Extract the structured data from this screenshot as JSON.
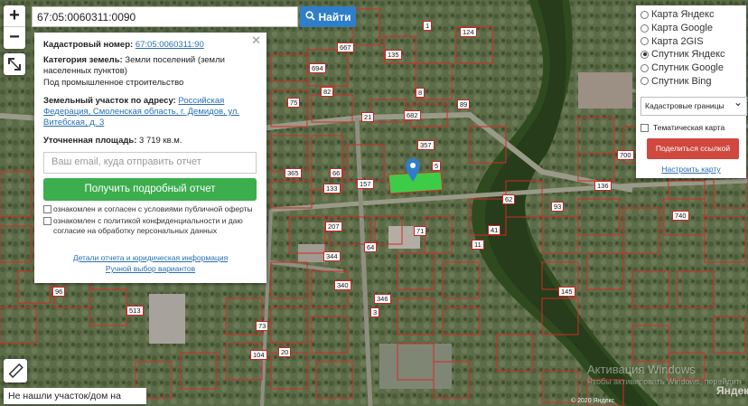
{
  "search": {
    "value": "67:05:0060311:0090",
    "button_label": "Найти"
  },
  "zoom": {
    "in": "+",
    "out": "−"
  },
  "info_panel": {
    "cadastral_label": "Кадастровый номер:",
    "cadastral_value": "67:05:0060311:90",
    "category_label": "Категория земель:",
    "category_value": "Земли поселений (земли населенных пунктов)",
    "usage_value": "Под промышленное строительство",
    "address_label": "Земельный участок по адресу:",
    "address_value": "Российская Федерация, Смоленская область, г. Демидов, ул. Витебская, д. 3",
    "area_label": "Уточненная площадь:",
    "area_value": "3 719 кв.м.",
    "email_placeholder": "Ваш email, куда отправить отчет",
    "report_button": "Получить подробный отчет",
    "consent_offer": "ознакомлен и согласен с условиями публичной оферты",
    "consent_privacy": "ознакомлен с политикой конфиденциальности и даю согласие на обработку персональных данных",
    "link_details": "Детали отчета и юридическая информация",
    "link_manual": "Ручной выбор вариантов"
  },
  "layers": {
    "options": [
      {
        "label": "Карта Яндекс",
        "selected": false
      },
      {
        "label": "Карта Google",
        "selected": false
      },
      {
        "label": "Карта 2GIS",
        "selected": false
      },
      {
        "label": "Спутник Яндекс",
        "selected": true
      },
      {
        "label": "Спутник Google",
        "selected": false
      },
      {
        "label": "Спутник Bing",
        "selected": false
      }
    ],
    "select_value": "Кадастровые границы",
    "thematic_label": "Тематическая карта",
    "share_button": "Поделиться ссылкой",
    "setup_link": "Настроить карту"
  },
  "not_found": "Не нашли участок/дом на карте?",
  "copyright": "© 2020 Яндекс",
  "yandex_logo": "Яндекс",
  "watermark": "Активация Windows",
  "watermark_sub": "Чтобы активировать Windows, перейдите в раздел «Параметры».",
  "plot_labels": [
    "667",
    "1",
    "124",
    "694",
    "135",
    "8",
    "82",
    "75",
    "21",
    "682",
    "89",
    "357",
    "5",
    "157",
    "365",
    "66",
    "133",
    "207",
    "71",
    "11",
    "41",
    "93",
    "62",
    "136",
    "700",
    "740",
    "145",
    "344",
    "340",
    "346",
    "513",
    "73",
    "104",
    "20",
    "96",
    "3",
    "64"
  ],
  "colors": {
    "search_button": "#2f7ec9",
    "report_button": "#3cae4e",
    "share_button": "#d0483e",
    "boundary": "#d42a2a"
  }
}
